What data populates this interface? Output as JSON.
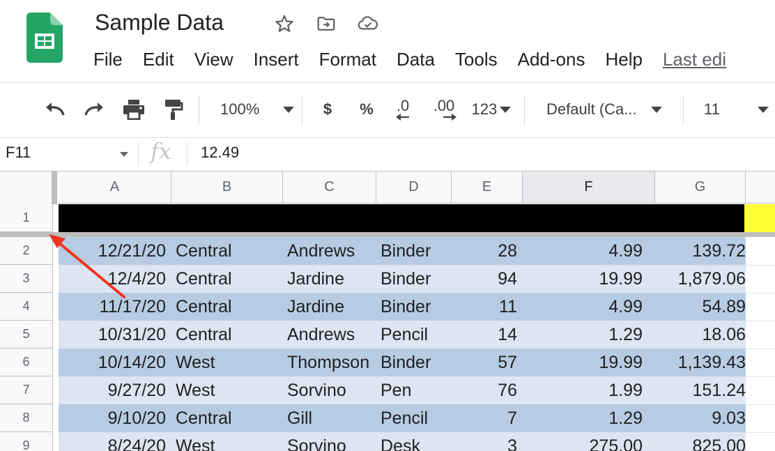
{
  "app": {
    "title": "Sample Data",
    "brand_color": "#0f9d58"
  },
  "title_icons": [
    "star-icon",
    "move-to-folder-icon",
    "cloud-saved-icon"
  ],
  "menu": [
    "File",
    "Edit",
    "View",
    "Insert",
    "Format",
    "Data",
    "Tools",
    "Add-ons",
    "Help"
  ],
  "last_edit_label": "Last edi",
  "toolbar": {
    "zoom": "100%",
    "currency_label": "$",
    "percent_label": "%",
    "decrease_decimal_label": ".0",
    "increase_decimal_label": ".00",
    "number_format_label": "123",
    "font_name": "Default (Ca...",
    "font_size": "11"
  },
  "formula_bar": {
    "name_box": "F11",
    "fx_label": "fx",
    "value": "12.49"
  },
  "grid": {
    "columns": [
      "A",
      "B",
      "C",
      "D",
      "E",
      "F",
      "G"
    ],
    "selected_column": "F",
    "row_numbers": [
      "1",
      "2",
      "3",
      "4",
      "5",
      "6",
      "7",
      "8",
      "9"
    ],
    "header_row_color": "#000000",
    "highlight_color": "#ffff33",
    "band_dark": "#b7cce2",
    "band_light": "#dce5f1",
    "rows": [
      [
        "12/21/20",
        "Central",
        "Andrews",
        "Binder",
        "28",
        "4.99",
        "139.72"
      ],
      [
        "12/4/20",
        "Central",
        "Jardine",
        "Binder",
        "94",
        "19.99",
        "1,879.06"
      ],
      [
        "11/17/20",
        "Central",
        "Jardine",
        "Binder",
        "11",
        "4.99",
        "54.89"
      ],
      [
        "10/31/20",
        "Central",
        "Andrews",
        "Pencil",
        "14",
        "1.29",
        "18.06"
      ],
      [
        "10/14/20",
        "West",
        "Thompson",
        "Binder",
        "57",
        "19.99",
        "1,139.43"
      ],
      [
        "9/27/20",
        "West",
        "Sorvino",
        "Pen",
        "76",
        "1.99",
        "151.24"
      ],
      [
        "9/10/20",
        "Central",
        "Gill",
        "Pencil",
        "7",
        "1.29",
        "9.03"
      ],
      [
        "8/24/20",
        "West",
        "Sorvino",
        "Desk",
        "3",
        "275.00",
        "825.00"
      ]
    ]
  },
  "annotation": {
    "arrow_color": "#f0341e"
  }
}
